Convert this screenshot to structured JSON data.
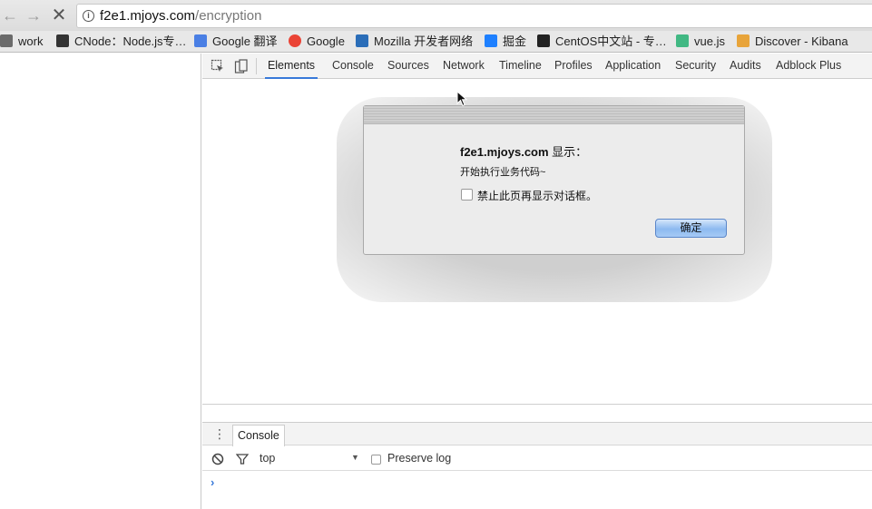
{
  "browser": {
    "url_host": "f2e1.mjoys.com",
    "url_path": "/encryption",
    "bookmarks": [
      {
        "label": "work",
        "icon": "folder-icon",
        "color": "#6b6b6b"
      },
      {
        "label": "CNode：Node.js专…",
        "icon": "cnode-icon",
        "color": "#333333"
      },
      {
        "label": "Google 翻译",
        "icon": "google-translate-icon",
        "color": "#4a7fe4"
      },
      {
        "label": "Google",
        "icon": "google-icon",
        "color": "#ea4335"
      },
      {
        "label": "Mozilla 开发者网络",
        "icon": "mozilla-icon",
        "color": "#2a6db8"
      },
      {
        "label": "掘金",
        "icon": "juejin-icon",
        "color": "#1e80ff"
      },
      {
        "label": "CentOS中文站 - 专…",
        "icon": "terminal-icon",
        "color": "#222222"
      },
      {
        "label": "vue.js",
        "icon": "vue-icon",
        "color": "#41b883"
      },
      {
        "label": "Discover - Kibana",
        "icon": "kibana-icon",
        "color": "#e8a43a"
      }
    ]
  },
  "devtools": {
    "tabs": [
      "Elements",
      "Console",
      "Sources",
      "Network",
      "Timeline",
      "Profiles",
      "Application",
      "Security",
      "Audits",
      "Adblock Plus"
    ],
    "active_tab": "Elements",
    "drawer_tab": "Console",
    "context": "top",
    "preserve_log": "Preserve log",
    "prompt": "›"
  },
  "dialog": {
    "title_host": "f2e1.mjoys.com",
    "title_suffix": " 显示：",
    "message": "开始执行业务代码~",
    "checkbox_label": "禁止此页再显示对话框。",
    "ok_label": "确定"
  },
  "colors": {
    "accent": "#3879d9"
  }
}
